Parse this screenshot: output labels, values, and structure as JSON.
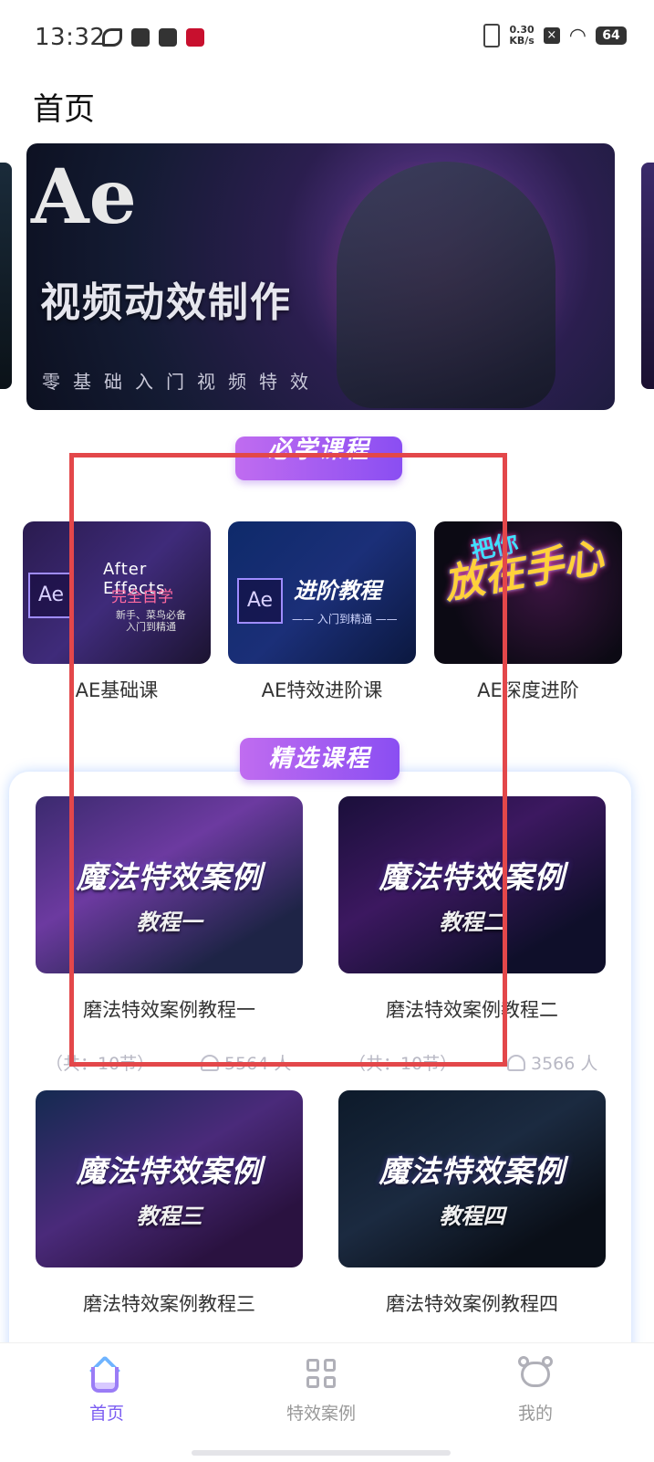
{
  "status_bar": {
    "time": "13:32",
    "net_speed_value": "0.30",
    "net_speed_unit": "KB/s",
    "battery": "64"
  },
  "header": {
    "title": "首页"
  },
  "banner": {
    "logo_text": "Ae",
    "title": "视频动效制作",
    "subtitle": "零基础入门视频特效"
  },
  "sections": {
    "required": "必学课程",
    "featured": "精选课程"
  },
  "required_courses": [
    {
      "label": "AE基础课",
      "thumb_logo": "Ae",
      "thumb_line1": "After Effects",
      "thumb_line2": "完全自学",
      "thumb_line3": "新手、菜鸟必备",
      "thumb_line4": "入门到精通"
    },
    {
      "label": "AE特效进阶课",
      "thumb_logo": "Ae",
      "thumb_title": "进阶教程",
      "thumb_sub": "—— 入门到精通 ——"
    },
    {
      "label": "AE深度进阶",
      "thumb_small": "把你",
      "thumb_big": "放在手心"
    }
  ],
  "featured_courses": [
    {
      "label": "磨法特效案例教程一",
      "thumb_title": "魔法特效案例",
      "thumb_sub": "教程一",
      "count": "（共：10节）",
      "people": "5564 人"
    },
    {
      "label": "磨法特效案例教程二",
      "thumb_title": "魔法特效案例",
      "thumb_sub": "教程二",
      "count": "（共：10节）",
      "people": "3566 人"
    },
    {
      "label": "磨法特效案例教程三",
      "thumb_title": "魔法特效案例",
      "thumb_sub": "教程三"
    },
    {
      "label": "磨法特效案例教程四",
      "thumb_title": "魔法特效案例",
      "thumb_sub": "教程四"
    }
  ],
  "tabbar": {
    "home": "首页",
    "cases": "特效案例",
    "mine": "我的"
  },
  "colors": {
    "accent": "#7b5cf2",
    "highlight_box": "#e3474a",
    "pill_gradient_start": "#c06cf0",
    "pill_gradient_end": "#8a4ef2"
  }
}
